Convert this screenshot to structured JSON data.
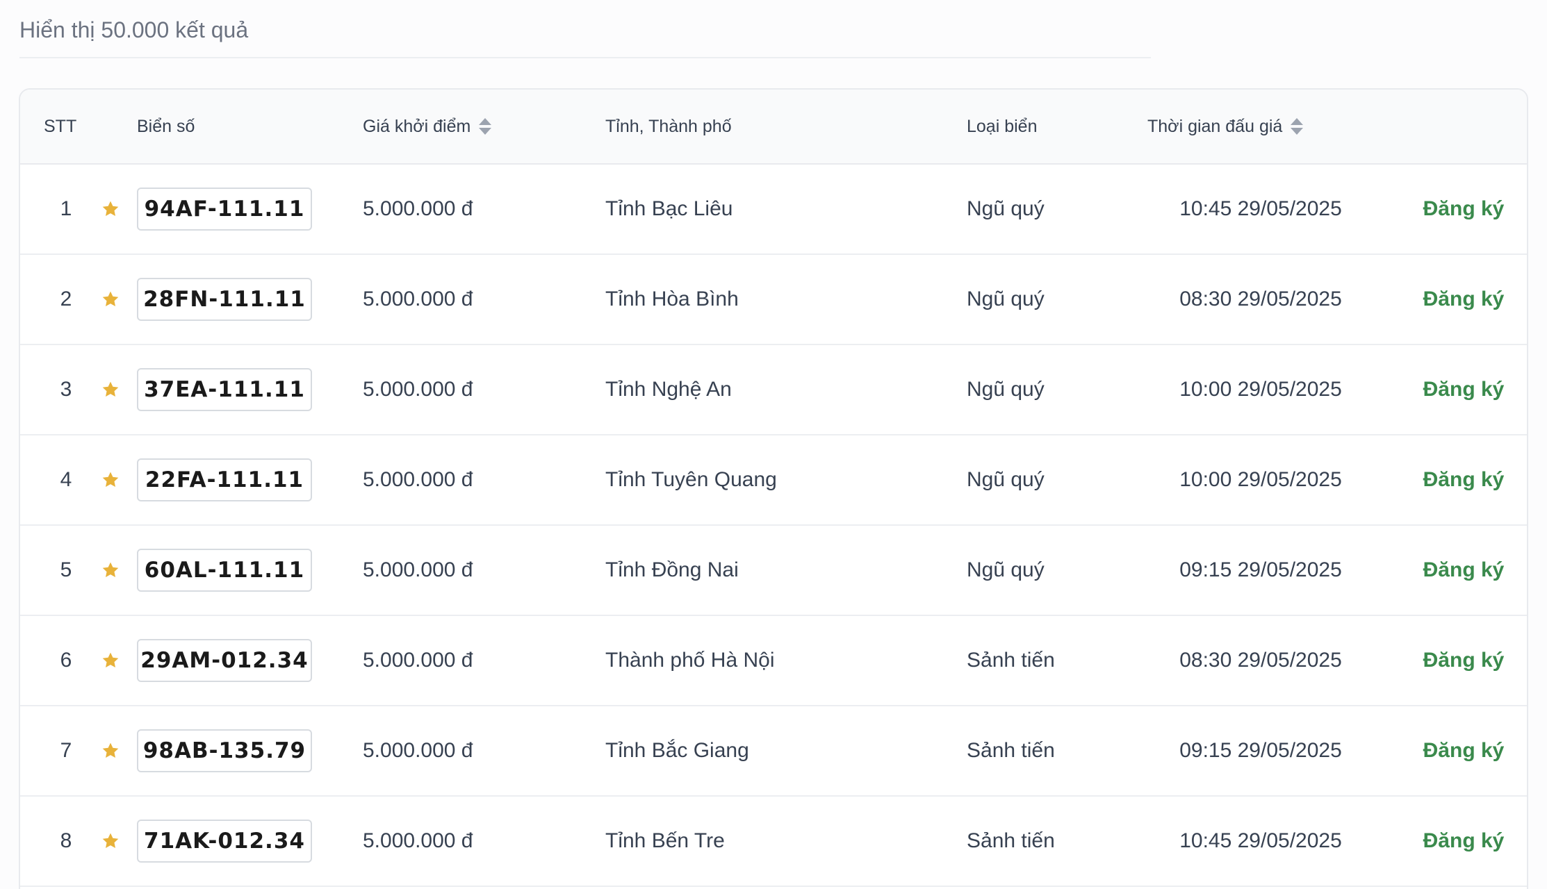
{
  "summary": "Hiển thị 50.000 kết quả",
  "columns": {
    "index": "STT",
    "plate": "Biển số",
    "price": "Giá khởi điểm",
    "province": "Tỉnh, Thành phố",
    "type": "Loại biển",
    "time": "Thời gian đấu giá"
  },
  "icons": {
    "favorite": "star-icon",
    "sort": "sort-icon"
  },
  "colors": {
    "star": "#e8b23a",
    "register": "#3a8a4c"
  },
  "rows": [
    {
      "index": "1",
      "plate": "94AF-111.11",
      "price": "5.000.000 đ",
      "province": "Tỉnh Bạc Liêu",
      "type": "Ngũ quý",
      "time": "10:45 29/05/2025",
      "action": "Đăng ký"
    },
    {
      "index": "2",
      "plate": "28FN-111.11",
      "price": "5.000.000 đ",
      "province": "Tỉnh Hòa Bình",
      "type": "Ngũ quý",
      "time": "08:30 29/05/2025",
      "action": "Đăng ký"
    },
    {
      "index": "3",
      "plate": "37EA-111.11",
      "price": "5.000.000 đ",
      "province": "Tỉnh Nghệ An",
      "type": "Ngũ quý",
      "time": "10:00 29/05/2025",
      "action": "Đăng ký"
    },
    {
      "index": "4",
      "plate": "22FA-111.11",
      "price": "5.000.000 đ",
      "province": "Tỉnh Tuyên Quang",
      "type": "Ngũ quý",
      "time": "10:00 29/05/2025",
      "action": "Đăng ký"
    },
    {
      "index": "5",
      "plate": "60AL-111.11",
      "price": "5.000.000 đ",
      "province": "Tỉnh Đồng Nai",
      "type": "Ngũ quý",
      "time": "09:15 29/05/2025",
      "action": "Đăng ký"
    },
    {
      "index": "6",
      "plate": "29AM-012.34",
      "price": "5.000.000 đ",
      "province": "Thành phố Hà Nội",
      "type": "Sảnh tiến",
      "time": "08:30 29/05/2025",
      "action": "Đăng ký"
    },
    {
      "index": "7",
      "plate": "98AB-135.79",
      "price": "5.000.000 đ",
      "province": "Tỉnh Bắc Giang",
      "type": "Sảnh tiến",
      "time": "09:15 29/05/2025",
      "action": "Đăng ký"
    },
    {
      "index": "8",
      "plate": "71AK-012.34",
      "price": "5.000.000 đ",
      "province": "Tỉnh Bến Tre",
      "type": "Sảnh tiến",
      "time": "10:45 29/05/2025",
      "action": "Đăng ký"
    }
  ]
}
